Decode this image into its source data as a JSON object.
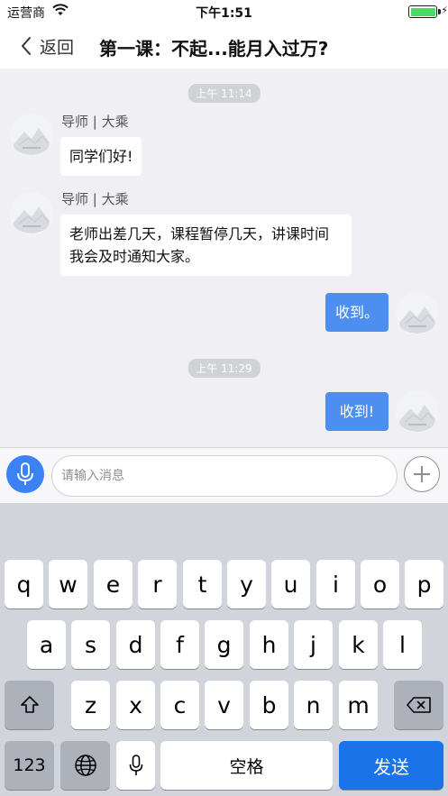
{
  "status_bar": {
    "carrier": "运营商",
    "time": "下午1:51",
    "battery_level": 1.0
  },
  "nav": {
    "back_label": "返回",
    "title": "第一课：不起...能月入过万?"
  },
  "chat": {
    "messages": [
      {
        "type": "time",
        "text": "上午 11:14"
      },
      {
        "type": "incoming",
        "sender": "导师 | 大乘",
        "text": "同学们好!"
      },
      {
        "type": "incoming",
        "sender": "导师 | 大乘",
        "text_line1": "老师出差几天，课程暂停几天，讲课时间",
        "text_line2": "我会及时通知大家。"
      },
      {
        "type": "outgoing",
        "text": "收到。"
      },
      {
        "type": "time",
        "text": "上午 11:29"
      },
      {
        "type": "outgoing",
        "text": "收到!"
      }
    ]
  },
  "input_bar": {
    "placeholder": "请输入消息",
    "value": ""
  },
  "keyboard": {
    "row1": [
      "q",
      "w",
      "e",
      "r",
      "t",
      "y",
      "u",
      "i",
      "o",
      "p"
    ],
    "row2": [
      "a",
      "s",
      "d",
      "f",
      "g",
      "h",
      "j",
      "k",
      "l"
    ],
    "row3": [
      "z",
      "x",
      "c",
      "v",
      "b",
      "n",
      "m"
    ],
    "numbers_key": "123",
    "space_key": "空格",
    "send_key": "发送",
    "icons": [
      "shift-icon",
      "backspace-icon",
      "globe-icon",
      "microphone-icon"
    ]
  },
  "colors": {
    "chat_background": "#efeff4",
    "outgoing_bubble": "#4d8ff0",
    "send_key": "#1a73e8",
    "mic_button": "#3b82f6",
    "keyboard_background": "#d1d4da"
  }
}
